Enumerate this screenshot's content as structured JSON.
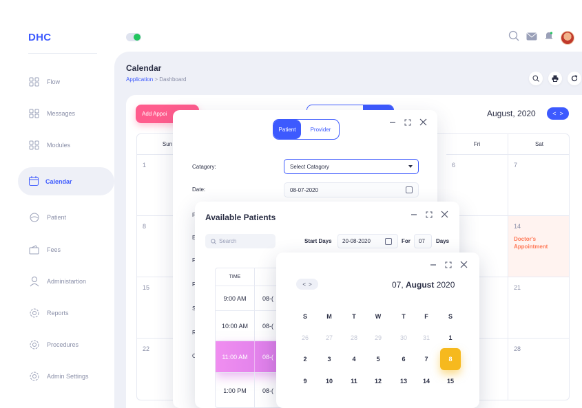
{
  "app": {
    "logo": "DHC"
  },
  "sidebar": {
    "items": [
      {
        "label": "Flow",
        "icon": "flow-icon"
      },
      {
        "label": "Messages",
        "icon": "messages-icon"
      },
      {
        "label": "Modules",
        "icon": "modules-icon"
      },
      {
        "label": "Calendar",
        "icon": "calendar-icon",
        "active": true
      },
      {
        "label": "Patient",
        "icon": "patient-icon"
      },
      {
        "label": "Fees",
        "icon": "fees-icon"
      },
      {
        "label": "Administartion",
        "icon": "user-icon"
      },
      {
        "label": "Reports",
        "icon": "gear-icon"
      },
      {
        "label": "Procedures",
        "icon": "gear-icon"
      },
      {
        "label": "Admin Settings",
        "icon": "gear-icon"
      }
    ]
  },
  "header": {
    "title": "Calendar",
    "crumb_app": "Application",
    "crumb_sep": " > ",
    "crumb_page": "Dashboard"
  },
  "calendar": {
    "add_button": "Add Appoi",
    "month": "August, 2020",
    "nav": {
      "prev": "<",
      "next": ">"
    },
    "days": [
      "Sun",
      "",
      "",
      "",
      "",
      "Fri",
      "Sat"
    ],
    "cells": [
      [
        "1",
        "6",
        "7"
      ],
      [
        "8",
        "",
        "14"
      ],
      [
        "15",
        "",
        "21"
      ],
      [
        "22",
        "",
        "28"
      ]
    ],
    "event": {
      "line1": "Doctor's",
      "line2": "Appointment"
    },
    "accent_color": "#3d5afe",
    "event_color": "#ff7a59"
  },
  "modal_appointment": {
    "tab_patient": "Patient",
    "tab_provider": "Provider",
    "category_label": "Catagory:",
    "category_value": "Select Catagory",
    "date_label": "Date:",
    "date_value": "08-07-2020",
    "row_letters": [
      "F",
      "E",
      "F",
      "F",
      "S",
      "R",
      "C"
    ]
  },
  "modal_patients": {
    "title": "Available Patients",
    "search_placeholder": "Search",
    "start_days_label": "Start Days",
    "start_days_value": "20-08-2020",
    "for_label": "For",
    "for_value": "07",
    "days_label": "Days",
    "col_time": "TIME",
    "rows": [
      {
        "time": "9:00 AM",
        "date": "08-("
      },
      {
        "time": "10:00 AM",
        "date": "08-("
      },
      {
        "time": "11:00 AM",
        "date": "08-(",
        "selected": true
      },
      {
        "time": "1:00 PM",
        "date": "08-("
      }
    ],
    "selected_color": "#e08aeb"
  },
  "date_picker": {
    "day_prefix": "07, ",
    "month": "August",
    "year": "2020",
    "nav_prev": "<",
    "nav_next": ">",
    "weekdays": [
      "S",
      "M",
      "T",
      "W",
      "T",
      "F",
      "S"
    ],
    "weeks": [
      [
        "26",
        "27",
        "28",
        "29",
        "30",
        "31",
        "1"
      ],
      [
        "2",
        "3",
        "4",
        "5",
        "6",
        "7",
        "8"
      ],
      [
        "9",
        "10",
        "11",
        "12",
        "13",
        "14",
        "15"
      ]
    ],
    "selected_day": "8",
    "selected_color": "#f6b91e"
  }
}
